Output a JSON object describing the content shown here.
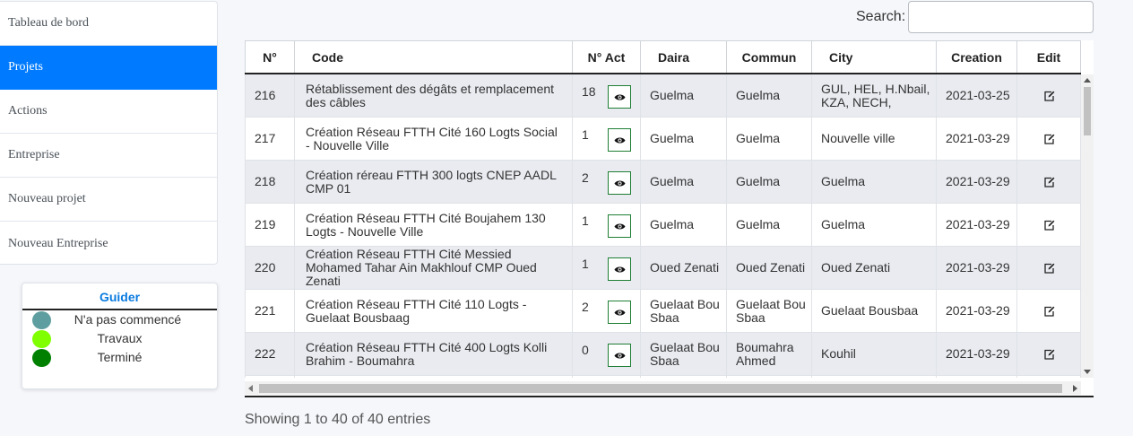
{
  "sidebar": {
    "items": [
      {
        "label": "Tableau de bord"
      },
      {
        "label": "Projets",
        "active": true
      },
      {
        "label": "Actions"
      },
      {
        "label": "Entreprise"
      },
      {
        "label": "Nouveau projet"
      },
      {
        "label": "Nouveau Entreprise"
      }
    ]
  },
  "guide": {
    "title": "Guider",
    "legend": [
      {
        "label": "N'a pas commencé",
        "color": "#5f9ea0"
      },
      {
        "label": "Travaux",
        "color": "#7fff00"
      },
      {
        "label": "Terminé",
        "color": "#008000"
      }
    ]
  },
  "search": {
    "label": "Search:",
    "value": ""
  },
  "table": {
    "headers": [
      "N°",
      "Code",
      "N° Act",
      "Daira",
      "Commun",
      "City",
      "Creation",
      "Edit"
    ],
    "rows": [
      {
        "n": "216",
        "code": "Rétablissement des dégâts et remplacement des câbles",
        "act": "18",
        "daira": "Guelma",
        "commun": "Guelma",
        "city": "GUL, HEL, H.Nbail, KZA, NECH,",
        "creation": "2021-03-25"
      },
      {
        "n": "217",
        "code": "Création Réseau FTTH Cité 160 Logts Social - Nouvelle Ville",
        "act": "1",
        "daira": "Guelma",
        "commun": "Guelma",
        "city": "Nouvelle ville",
        "creation": "2021-03-29"
      },
      {
        "n": "218",
        "code": "Création réreau FTTH 300 logts CNEP AADL CMP 01",
        "act": "2",
        "daira": "Guelma",
        "commun": "Guelma",
        "city": "Guelma",
        "creation": "2021-03-29"
      },
      {
        "n": "219",
        "code": "Création Réseau FTTH Cité Boujahem 130 Logts - Nouvelle Ville",
        "act": "1",
        "daira": "Guelma",
        "commun": "Guelma",
        "city": "Guelma",
        "creation": "2021-03-29"
      },
      {
        "n": "220",
        "code": "Création Réseau FTTH Cité Messied Mohamed Tahar Ain Makhlouf CMP Oued Zenati",
        "act": "1",
        "daira": "Oued Zenati",
        "commun": "Oued Zenati",
        "city": "Oued Zenati",
        "creation": "2021-03-29"
      },
      {
        "n": "221",
        "code": "Création Réseau FTTH Cité 110 Logts - Guelaat Bousbaag",
        "act": "2",
        "daira": "Guelaat Bou Sbaa",
        "commun": "Guelaat Bou Sbaa",
        "city": "Guelaat Bousbaa",
        "creation": "2021-03-29"
      },
      {
        "n": "222",
        "code": "Création Réseau FTTH Cité 400 Logts Kolli Brahim - Boumahra",
        "act": "0",
        "daira": "Guelaat Bou Sbaa",
        "commun": "Boumahra Ahmed",
        "city": "Kouhil",
        "creation": "2021-03-29"
      }
    ]
  },
  "footer": {
    "info": "Showing 1 to 40 of 40 entries"
  }
}
